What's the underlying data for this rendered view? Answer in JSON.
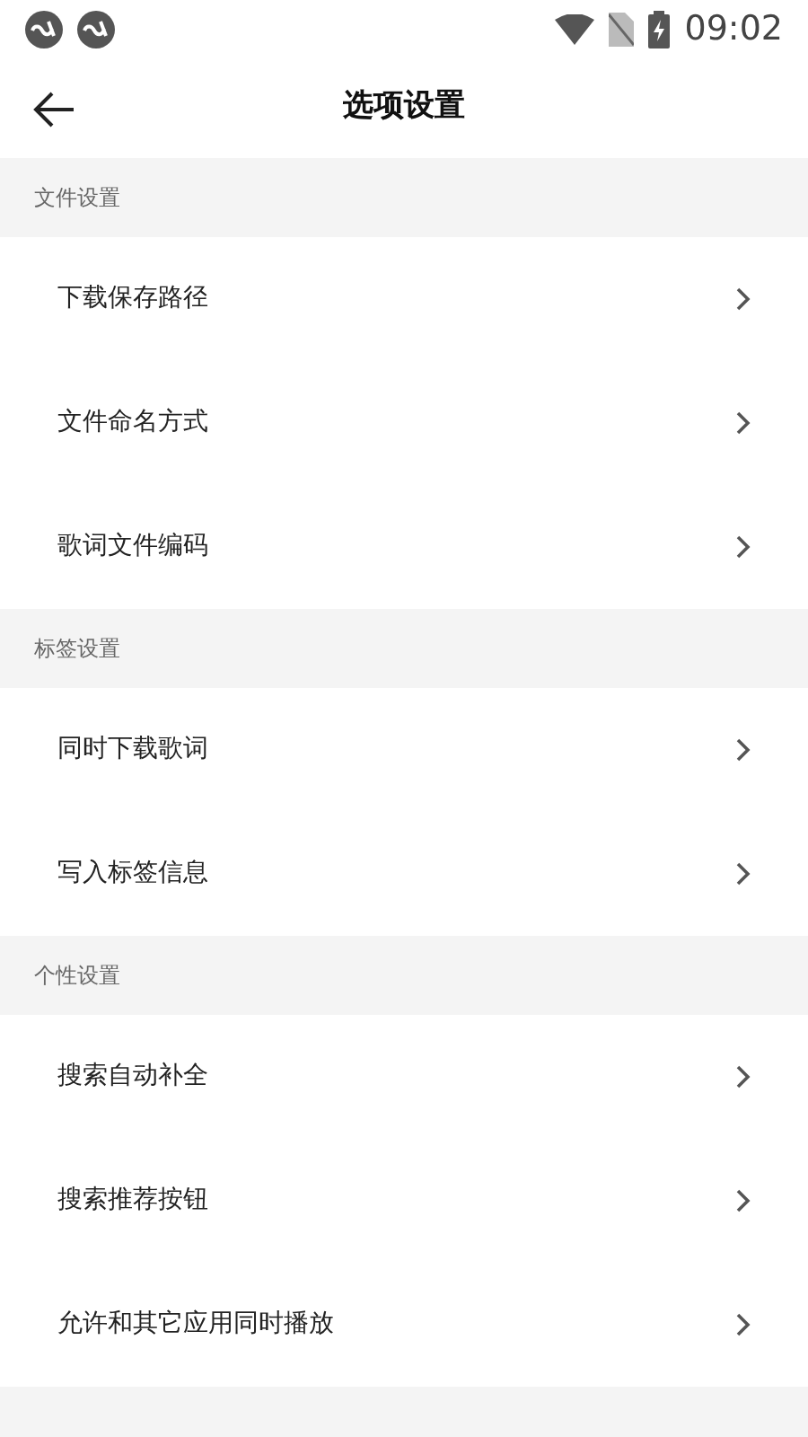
{
  "status_bar": {
    "time": "09:02"
  },
  "header": {
    "title": "选项设置"
  },
  "sections": [
    {
      "title": "文件设置",
      "items": [
        {
          "label": "下载保存路径"
        },
        {
          "label": "文件命名方式"
        },
        {
          "label": "歌词文件编码"
        }
      ]
    },
    {
      "title": "标签设置",
      "items": [
        {
          "label": "同时下载歌词"
        },
        {
          "label": "写入标签信息"
        }
      ]
    },
    {
      "title": "个性设置",
      "items": [
        {
          "label": "搜索自动补全"
        },
        {
          "label": "搜索推荐按钮"
        },
        {
          "label": "允许和其它应用同时播放"
        }
      ]
    }
  ]
}
